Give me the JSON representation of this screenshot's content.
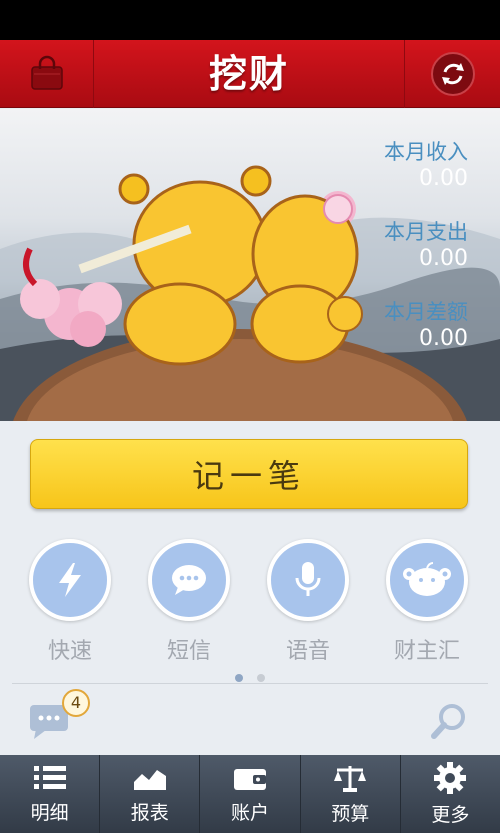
{
  "header": {
    "title": "挖财"
  },
  "stats": [
    {
      "label": "本月收入",
      "value": "0.00"
    },
    {
      "label": "本月支出",
      "value": "0.00"
    },
    {
      "label": "本月差额",
      "value": "0.00"
    }
  ],
  "record_button": {
    "label": "记一笔"
  },
  "quick_actions": [
    {
      "label": "快速",
      "icon": "lightning-icon"
    },
    {
      "label": "短信",
      "icon": "chat-bubble-icon"
    },
    {
      "label": "语音",
      "icon": "microphone-icon"
    },
    {
      "label": "财主汇",
      "icon": "mascot-icon"
    }
  ],
  "message_badge": {
    "count": "4"
  },
  "tabs": [
    {
      "label": "明细",
      "icon": "list-icon"
    },
    {
      "label": "报表",
      "icon": "chart-icon"
    },
    {
      "label": "账户",
      "icon": "wallet-icon"
    },
    {
      "label": "预算",
      "icon": "scale-icon"
    },
    {
      "label": "更多",
      "icon": "gear-icon"
    }
  ],
  "colors": {
    "header_red": "#c8121a",
    "accent_yellow": "#f9cf24",
    "stat_label_blue": "#4a8fc0",
    "quick_circle": "#a8c4ec",
    "tabbar": "#3f4957"
  }
}
